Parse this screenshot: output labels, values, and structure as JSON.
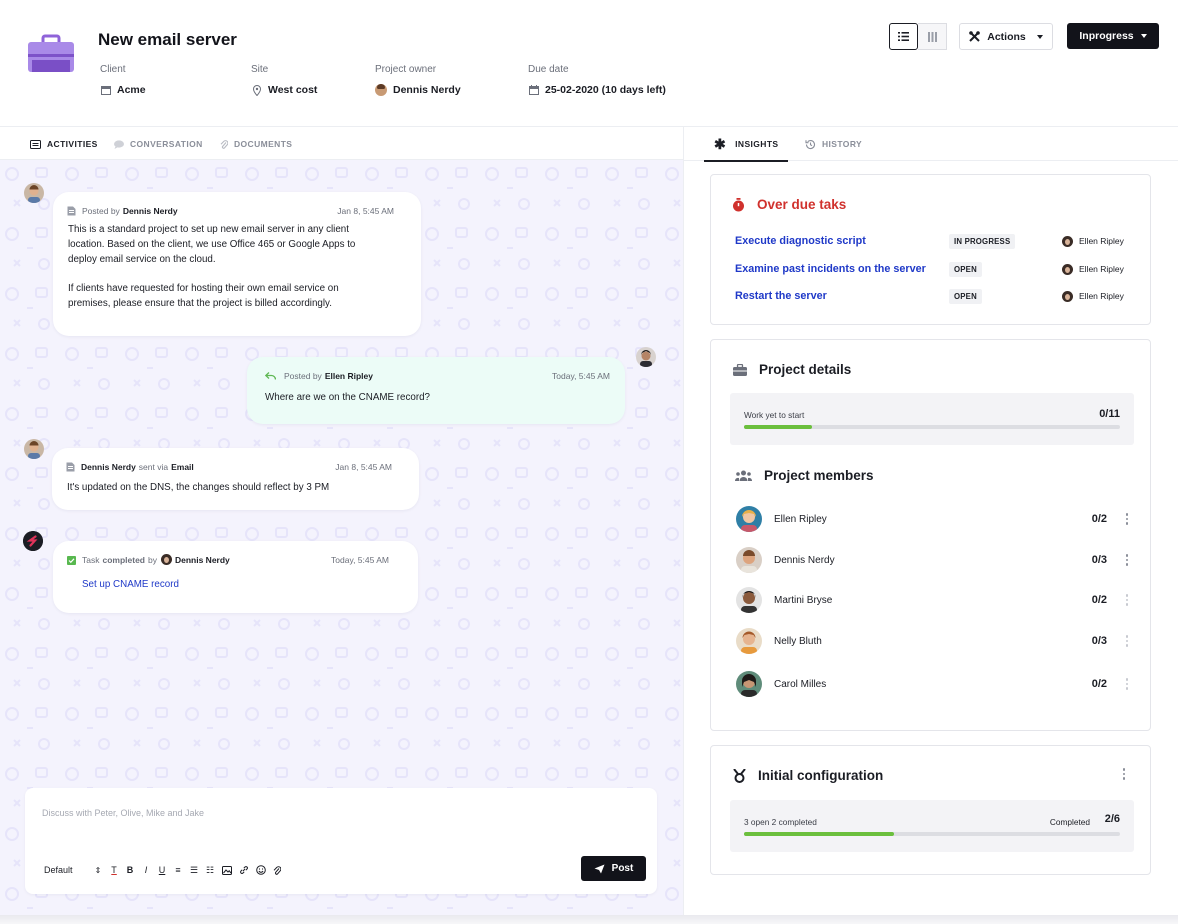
{
  "project": {
    "title": "New email server",
    "client_label": "Client",
    "client_value": "Acme",
    "site_label": "Site",
    "site_value": "West cost",
    "owner_label": "Project owner",
    "owner_value": "Dennis Nerdy",
    "due_label": "Due date",
    "due_value": "25-02-2020 (10 days left)"
  },
  "toolbar": {
    "actions_label": "Actions",
    "status_label": "Inprogress"
  },
  "left_tabs": [
    "ACTIVITIES",
    "CONVERSATION",
    "DOCUMENTS"
  ],
  "right_tabs": [
    "INSIGHTS",
    "HISTORY"
  ],
  "messages": {
    "m1": {
      "posted_by": "Posted by",
      "author": "Dennis Nerdy",
      "time": "Jan 8, 5:45 AM",
      "lines": [
        "This is a standard project to set up new email server in any client",
        "location. Based on the client, we use Office 465 or Google Apps to",
        "deploy email service on the cloud.",
        "",
        "If clients have requested for hosting their own email service on",
        "premises, please ensure that the project is billed accordingly."
      ]
    },
    "m2": {
      "posted_by": "Posted by",
      "author": "Ellen Ripley",
      "time": "Today, 5:45 AM",
      "text": "Where are we on the CNAME record?"
    },
    "m3": {
      "author": "Dennis Nerdy",
      "sent_via": "sent via",
      "channel": "Email",
      "time": "Jan 8, 5:45 AM",
      "text": "It's updated on the DNS, the changes should reflect by 3 PM"
    },
    "m4": {
      "task_word": "Task",
      "completed": "completed",
      "by": "by",
      "author": "Dennis Nerdy",
      "time": "Today, 5:45 AM",
      "task_link": "Set up CNAME record"
    }
  },
  "composer": {
    "placeholder": "Discuss with Peter, Olive, Mike and Jake",
    "format_select": "Default",
    "post_label": "Post"
  },
  "overdue": {
    "title": "Over due taks",
    "tasks": [
      {
        "name": "Execute diagnostic script",
        "status": "IN PROGRESS",
        "assignee": "Ellen Ripley"
      },
      {
        "name": "Examine past incidents on the server",
        "status": "OPEN",
        "assignee": "Ellen Ripley"
      },
      {
        "name": "Restart the server",
        "status": "OPEN",
        "assignee": "Ellen Ripley"
      }
    ]
  },
  "details": {
    "title": "Project details",
    "work_label": "Work yet to start",
    "work_count": "0/11",
    "work_progress": 0.18,
    "members_title": "Project members",
    "members": [
      {
        "name": "Ellen Ripley",
        "count": "0/2"
      },
      {
        "name": "Dennis Nerdy",
        "count": "0/3"
      },
      {
        "name": "Martini Bryse",
        "count": "0/2"
      },
      {
        "name": "Nelly Bluth",
        "count": "0/3"
      },
      {
        "name": "Carol Milles",
        "count": "0/2"
      }
    ]
  },
  "config": {
    "title": "Initial configuration",
    "summary": "3 open 2 completed",
    "completed_label": "Completed",
    "completed_count": "2/6",
    "progress": 0.4
  },
  "colors": {
    "accent_link": "#1f39c8",
    "overdue_red": "#d0312d",
    "progress_green": "#6bbf3d",
    "brand_purple": "#9b6ee0"
  }
}
